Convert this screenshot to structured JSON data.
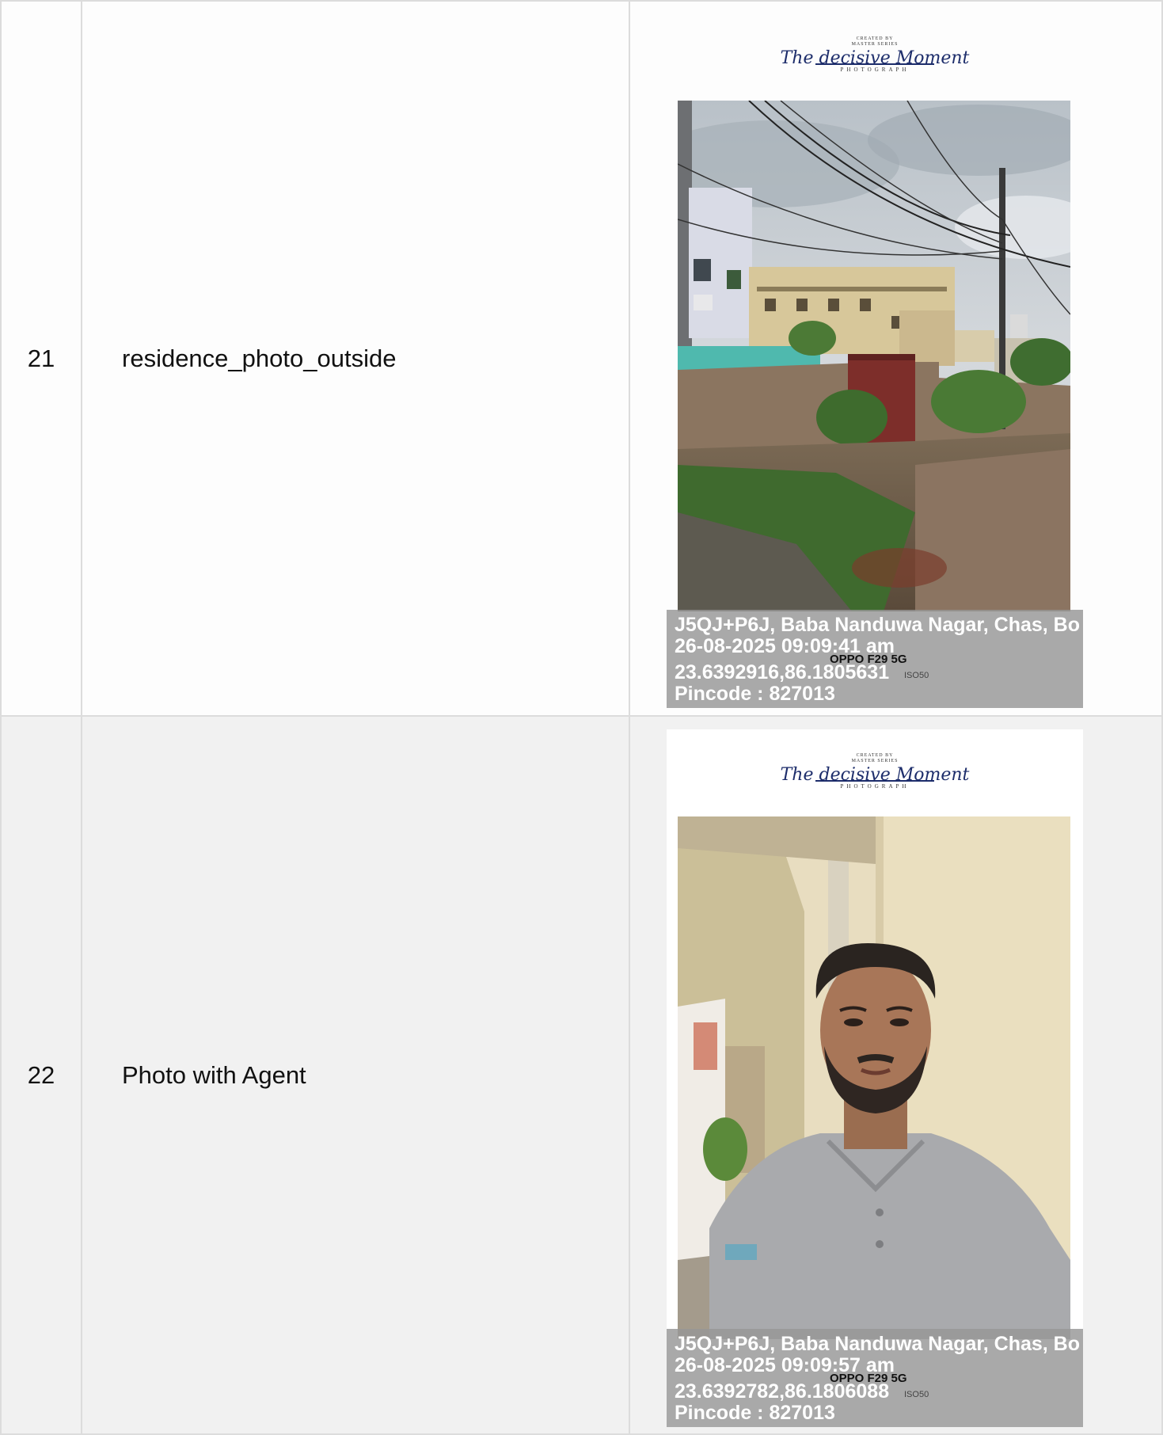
{
  "rows": [
    {
      "num": "21",
      "label": "residence_photo_outside",
      "watermark": {
        "top": "CREATED BY",
        "top2": "MASTER SERIES",
        "script": "The decisive Moment",
        "bottom": "PHOTOGRAPH"
      },
      "stamp": {
        "address": "J5QJ+P6J, Baba Nanduwa Nagar, Chas, Bo",
        "datetime": "26-08-2025 09:09:41 am",
        "coords": "23.6392916,86.1805631",
        "pincode": "Pincode : 827013",
        "device": "OPPO F29 5G",
        "meta": "ISO50"
      }
    },
    {
      "num": "22",
      "label": "Photo with Agent",
      "watermark": {
        "top": "CREATED BY",
        "top2": "MASTER SERIES",
        "script": "The decisive Moment",
        "bottom": "PHOTOGRAPH"
      },
      "stamp": {
        "address": "J5QJ+P6J, Baba Nanduwa Nagar, Chas, Bo",
        "datetime": "26-08-2025 09:09:57 am",
        "coords": "23.6392782,86.1806088",
        "pincode": "Pincode : 827013",
        "device": "OPPO F29 5G",
        "meta": "ISO50"
      }
    }
  ]
}
